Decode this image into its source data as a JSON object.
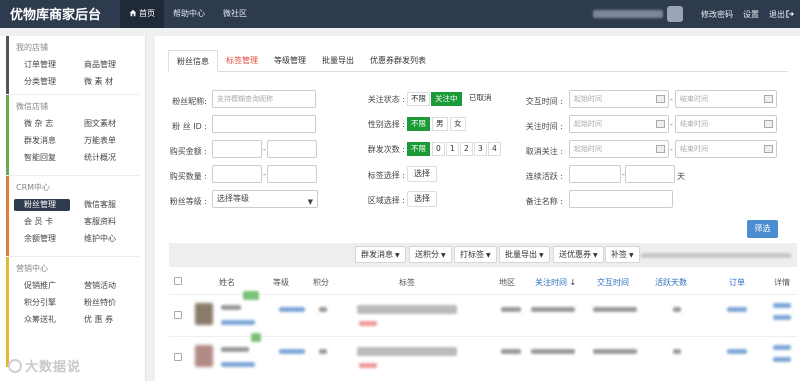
{
  "topbar": {
    "brand": "优物库商家后台",
    "nav": [
      "首页",
      "帮助中心",
      "微社区"
    ],
    "right_links": [
      "修改密码",
      "设置",
      "退出"
    ],
    "logout_icon": "logout-icon",
    "home_icon": "home-icon"
  },
  "sidebar": {
    "groups": [
      {
        "title": "我的店铺",
        "color": "#555555",
        "items": [
          "订单管理",
          "商品管理",
          "分类管理",
          "微 素 材"
        ]
      },
      {
        "title": "微信店铺",
        "color": "#6aa84f",
        "items": [
          "微 杂 志",
          "图文素材",
          "群发消息",
          "万能表单",
          "智能回复",
          "统计概况"
        ]
      },
      {
        "title": "CRM中心",
        "color": "#e07b3a",
        "items": [
          "粉丝管理",
          "微信客服",
          "会 员 卡",
          "客服资料",
          "余额管理",
          "维护中心"
        ],
        "active": "粉丝管理"
      },
      {
        "title": "营销中心",
        "color": "#e5b836",
        "items": [
          "促销推广",
          "营销活动",
          "积分引擎",
          "粉丝特价",
          "众筹送礼",
          "优 惠 券"
        ]
      }
    ]
  },
  "tabs": [
    "粉丝信息",
    "标签管理",
    "等级管理",
    "批量导出",
    "优惠券群发列表"
  ],
  "filters": {
    "nickname_label": "粉丝昵称:",
    "nickname_placeholder": "支持模糊查询昵称",
    "fanid_label": "粉 丝 ID :",
    "amount_label": "购买金额 :",
    "quantity_label": "购买数量 :",
    "level_label": "粉丝等级 :",
    "level_value": "选择等级",
    "follow_label": "关注状态 :",
    "follow_options": [
      "不限",
      "关注中",
      "已取消"
    ],
    "follow_selected": "关注中",
    "gender_label": "性别选择 :",
    "gender_options": [
      "不限",
      "男",
      "女"
    ],
    "gender_selected": "不限",
    "mass_label": "群发次数 :",
    "mass_options": [
      "不限",
      "0",
      "1",
      "2",
      "3",
      "4"
    ],
    "mass_selected": "不限",
    "tag_label": "标签选择 :",
    "tag_button": "选择",
    "region_label": "区域选择 :",
    "region_button": "选择",
    "interact_label": "交互时间 :",
    "follow_time_label": "关注时间 :",
    "unfollow_label": "取消关注 :",
    "consecutive_label": "连续活跃 :",
    "consecutive_unit": "天",
    "remark_label": "备注名称 :",
    "start_placeholder": "起始时间",
    "end_placeholder": "结束时间",
    "filter_button": "筛选"
  },
  "toolbar": [
    "群发消息",
    "送积分",
    "打标签",
    "批量导出",
    "送优惠券",
    "补签"
  ],
  "table_headers": [
    "姓名",
    "等级",
    "积分",
    "标签",
    "地区",
    "关注时间",
    "交互时间",
    "活跃天数",
    "订单",
    "详情"
  ],
  "watermark": "大数据说"
}
